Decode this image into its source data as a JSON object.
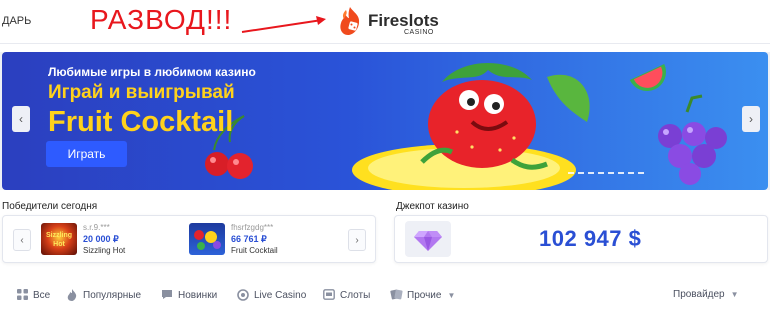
{
  "header": {
    "left_text": "ДАРЬ",
    "overlay_text": "РАЗВОД!!!",
    "logo_name": "Fireslots",
    "logo_sub": "CASINO"
  },
  "banner": {
    "subtitle": "Любимые игры в любимом казино",
    "line1": "Играй и выигрывай",
    "line2": "Fruit Cocktail",
    "play_label": "Играть",
    "prev_label": "‹",
    "next_label": "›"
  },
  "winners": {
    "title": "Победители сегодня",
    "prev_label": "‹",
    "next_label": "›",
    "items": [
      {
        "name": "s.r.9.***",
        "amount": "20 000 ₽",
        "game": "Sizzling Hot",
        "thumb_text": "Sizzling\nHot"
      },
      {
        "name": "fhsrfzgdg***",
        "amount": "66 761 ₽",
        "game": "Fruit Cocktail",
        "thumb_text": ""
      }
    ]
  },
  "jackpot": {
    "title": "Джекпот казино",
    "value": "102 947 $"
  },
  "tabs": [
    {
      "label": "Все",
      "icon": "grid-icon"
    },
    {
      "label": "Популярные",
      "icon": "fire-icon"
    },
    {
      "label": "Новинки",
      "icon": "bubble-icon"
    },
    {
      "label": "Live Casino",
      "icon": "chip-icon"
    },
    {
      "label": "Слоты",
      "icon": "slot-icon"
    },
    {
      "label": "Прочие",
      "icon": "cards-icon"
    },
    {
      "label": "Провайдер",
      "icon": ""
    }
  ],
  "colors": {
    "accent": "#2e5bff",
    "overlay_red": "#e8171d",
    "banner_yellow": "#ffd21c",
    "jackpot_blue": "#2a4fd4"
  }
}
